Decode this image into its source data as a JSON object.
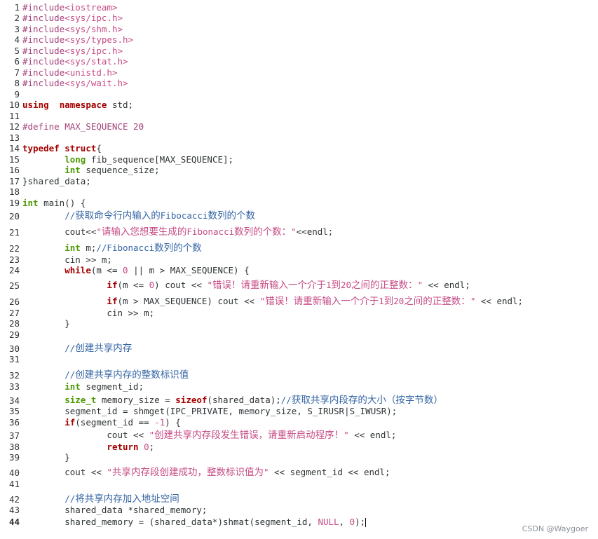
{
  "editor": {
    "current_line": "44",
    "lines": [
      {
        "n": "1",
        "h": 15.5,
        "t": [
          [
            "pp",
            "#include"
          ],
          [
            "inc",
            "<iostream>"
          ]
        ]
      },
      {
        "n": "2",
        "h": 15.5,
        "t": [
          [
            "pp",
            "#include"
          ],
          [
            "inc",
            "<sys/ipc.h>"
          ]
        ]
      },
      {
        "n": "3",
        "h": 15.5,
        "t": [
          [
            "pp",
            "#include"
          ],
          [
            "inc",
            "<sys/shm.h>"
          ]
        ]
      },
      {
        "n": "4",
        "h": 15.5,
        "t": [
          [
            "pp",
            "#include"
          ],
          [
            "inc",
            "<sys/types.h>"
          ]
        ]
      },
      {
        "n": "5",
        "h": 15.5,
        "t": [
          [
            "pp",
            "#include"
          ],
          [
            "inc",
            "<sys/ipc.h>"
          ]
        ]
      },
      {
        "n": "6",
        "h": 15.5,
        "t": [
          [
            "pp",
            "#include"
          ],
          [
            "inc",
            "<sys/stat.h>"
          ]
        ]
      },
      {
        "n": "7",
        "h": 15.5,
        "t": [
          [
            "pp",
            "#include"
          ],
          [
            "inc",
            "<unistd.h>"
          ]
        ]
      },
      {
        "n": "8",
        "h": 15.5,
        "t": [
          [
            "pp",
            "#include"
          ],
          [
            "inc",
            "<sys/wait.h>"
          ]
        ]
      },
      {
        "n": "9",
        "h": 15.5,
        "t": []
      },
      {
        "n": "10",
        "h": 15.5,
        "t": [
          [
            "kw",
            "using"
          ],
          [
            "",
            "  "
          ],
          [
            "kw",
            "namespace"
          ],
          [
            "",
            " std;"
          ]
        ]
      },
      {
        "n": "11",
        "h": 15.5,
        "t": []
      },
      {
        "n": "12",
        "h": 15.5,
        "t": [
          [
            "pp",
            "#define MAX_SEQUENCE 20"
          ]
        ]
      },
      {
        "n": "13",
        "h": 15.5,
        "t": []
      },
      {
        "n": "14",
        "h": 15.5,
        "t": [
          [
            "kw",
            "typedef"
          ],
          [
            "",
            " "
          ],
          [
            "kw",
            "struct"
          ],
          [
            "",
            "{"
          ]
        ]
      },
      {
        "n": "15",
        "h": 15.5,
        "t": [
          [
            "",
            "        "
          ],
          [
            "type",
            "long"
          ],
          [
            "",
            " fib_sequence[MAX_SEQUENCE];"
          ]
        ]
      },
      {
        "n": "16",
        "h": 15.5,
        "t": [
          [
            "",
            "        "
          ],
          [
            "type",
            "int"
          ],
          [
            "",
            " sequence_size;"
          ]
        ]
      },
      {
        "n": "17",
        "h": 15.5,
        "t": [
          [
            "",
            "}shared_data;"
          ]
        ]
      },
      {
        "n": "18",
        "h": 15.5,
        "t": []
      },
      {
        "n": "19",
        "h": 15.5,
        "t": [
          [
            "type",
            "int"
          ],
          [
            "",
            " main() {"
          ]
        ]
      },
      {
        "n": "20",
        "h": 19.5,
        "t": [
          [
            "",
            "        "
          ],
          [
            "com",
            "//"
          ],
          [
            "comzh",
            "获取命令行内输入的"
          ],
          [
            "com",
            "Fibocacci"
          ],
          [
            "comzh",
            "数列的个数"
          ]
        ]
      },
      {
        "n": "21",
        "h": 23,
        "t": [
          [
            "",
            "        cout<<"
          ],
          [
            "str",
            "\""
          ],
          [
            "strzh",
            "请输入您想要生成的"
          ],
          [
            "str",
            "Fibonacci"
          ],
          [
            "strzh",
            "数列的个数："
          ],
          [
            "str",
            "\""
          ],
          [
            "",
            "<<endl;"
          ]
        ]
      },
      {
        "n": "22",
        "h": 23,
        "t": [
          [
            "",
            "        "
          ],
          [
            "type",
            "int"
          ],
          [
            "",
            " m;"
          ],
          [
            "com",
            "//Fibonacci"
          ],
          [
            "comzh",
            "数列的个数"
          ]
        ]
      },
      {
        "n": "23",
        "h": 15.5,
        "t": [
          [
            "",
            "        cin >> m;"
          ]
        ]
      },
      {
        "n": "24",
        "h": 15.5,
        "t": [
          [
            "",
            "        "
          ],
          [
            "kw",
            "while"
          ],
          [
            "",
            "(m <= "
          ],
          [
            "num",
            "0"
          ],
          [
            "",
            " || m > MAX_SEQUENCE) {"
          ]
        ]
      },
      {
        "n": "25",
        "h": 22,
        "t": [
          [
            "",
            "                "
          ],
          [
            "kw",
            "if"
          ],
          [
            "",
            "(m <= "
          ],
          [
            "num",
            "0"
          ],
          [
            "",
            ") cout << "
          ],
          [
            "str",
            "\""
          ],
          [
            "strzh",
            "错误！请重新输入一个介于"
          ],
          [
            "str",
            "1"
          ],
          [
            "strzh",
            "到"
          ],
          [
            "str",
            "20"
          ],
          [
            "strzh",
            "之间的正整数："
          ],
          [
            "str",
            "\""
          ],
          [
            "",
            " << endl;"
          ]
        ]
      },
      {
        "n": "26",
        "h": 23,
        "t": [
          [
            "",
            "                "
          ],
          [
            "kw",
            "if"
          ],
          [
            "",
            "(m > MAX_SEQUENCE) cout << "
          ],
          [
            "str",
            "\""
          ],
          [
            "strzh",
            "错误！请重新输入一个介于"
          ],
          [
            "str",
            "1"
          ],
          [
            "strzh",
            "到"
          ],
          [
            "str",
            "20"
          ],
          [
            "strzh",
            "之间的正整数："
          ],
          [
            "str",
            "\""
          ],
          [
            "",
            " << endl;"
          ]
        ]
      },
      {
        "n": "27",
        "h": 15.5,
        "t": [
          [
            "",
            "                cin >> m;"
          ]
        ]
      },
      {
        "n": "28",
        "h": 15.5,
        "t": [
          [
            "",
            "        }"
          ]
        ]
      },
      {
        "n": "29",
        "h": 15.5,
        "t": []
      },
      {
        "n": "30",
        "h": 20,
        "t": [
          [
            "",
            "        "
          ],
          [
            "com",
            "//"
          ],
          [
            "comzh",
            "创建共享内存"
          ]
        ]
      },
      {
        "n": "31",
        "h": 15.5,
        "t": []
      },
      {
        "n": "32",
        "h": 23,
        "t": [
          [
            "",
            "        "
          ],
          [
            "com",
            "//"
          ],
          [
            "comzh",
            "创建共享内存的整数标识值"
          ]
        ]
      },
      {
        "n": "33",
        "h": 15.5,
        "t": [
          [
            "",
            "        "
          ],
          [
            "type",
            "int"
          ],
          [
            "",
            " segment_id;"
          ]
        ]
      },
      {
        "n": "34",
        "h": 20,
        "t": [
          [
            "",
            "        "
          ],
          [
            "type",
            "size_t"
          ],
          [
            "",
            " memory_size = "
          ],
          [
            "kw",
            "sizeof"
          ],
          [
            "",
            "(shared_data);"
          ],
          [
            "com",
            "//"
          ],
          [
            "comzh",
            "获取共享内段存的大小（按字节数）"
          ]
        ]
      },
      {
        "n": "35",
        "h": 15.5,
        "t": [
          [
            "",
            "        segment_id = shmget(IPC_PRIVATE, memory_size, S_IRUSR|S_IWUSR);"
          ]
        ]
      },
      {
        "n": "36",
        "h": 15.5,
        "t": [
          [
            "",
            "        "
          ],
          [
            "kw",
            "if"
          ],
          [
            "",
            "(segment_id == "
          ],
          [
            "num",
            "-1"
          ],
          [
            "",
            ") {"
          ]
        ]
      },
      {
        "n": "37",
        "h": 19.5,
        "t": [
          [
            "",
            "                cout << "
          ],
          [
            "str",
            "\""
          ],
          [
            "strzh",
            "创建共享内存段发生错误，请重新启动程序！"
          ],
          [
            "str",
            "\""
          ],
          [
            "",
            " << endl;"
          ]
        ]
      },
      {
        "n": "38",
        "h": 15.5,
        "t": [
          [
            "",
            "                "
          ],
          [
            "kw",
            "return"
          ],
          [
            "",
            " "
          ],
          [
            "num",
            "0"
          ],
          [
            "",
            ";"
          ]
        ]
      },
      {
        "n": "39",
        "h": 15.5,
        "t": [
          [
            "",
            "        }"
          ]
        ]
      },
      {
        "n": "40",
        "h": 22,
        "t": [
          [
            "",
            "        cout << "
          ],
          [
            "str",
            "\""
          ],
          [
            "strzh",
            "共享内存段创建成功，整数标识值为"
          ],
          [
            "str",
            "\""
          ],
          [
            "",
            " << segment_id << endl;"
          ]
        ]
      },
      {
        "n": "41",
        "h": 15.5,
        "t": []
      },
      {
        "n": "42",
        "h": 22,
        "t": [
          [
            "",
            "        "
          ],
          [
            "com",
            "//"
          ],
          [
            "comzh",
            "将共享内存加入地址空间"
          ]
        ]
      },
      {
        "n": "43",
        "h": 15.5,
        "t": [
          [
            "",
            "        shared_data *shared_memory;"
          ]
        ]
      },
      {
        "n": "44",
        "h": 17,
        "t": [
          [
            "",
            "        shared_memory = (shared_data*)shmat(segment_id, "
          ],
          [
            "num",
            "NULL"
          ],
          [
            "",
            ", "
          ],
          [
            "num",
            "0"
          ],
          [
            "",
            ");"
          ]
        ]
      }
    ]
  },
  "colors": {
    "keyword": "#a40000",
    "type": "#4e9a06",
    "preprocessor": "#a5437b",
    "string": "#c64b85",
    "comment": "#3465a4"
  },
  "watermark": "CSDN @Waygoer"
}
